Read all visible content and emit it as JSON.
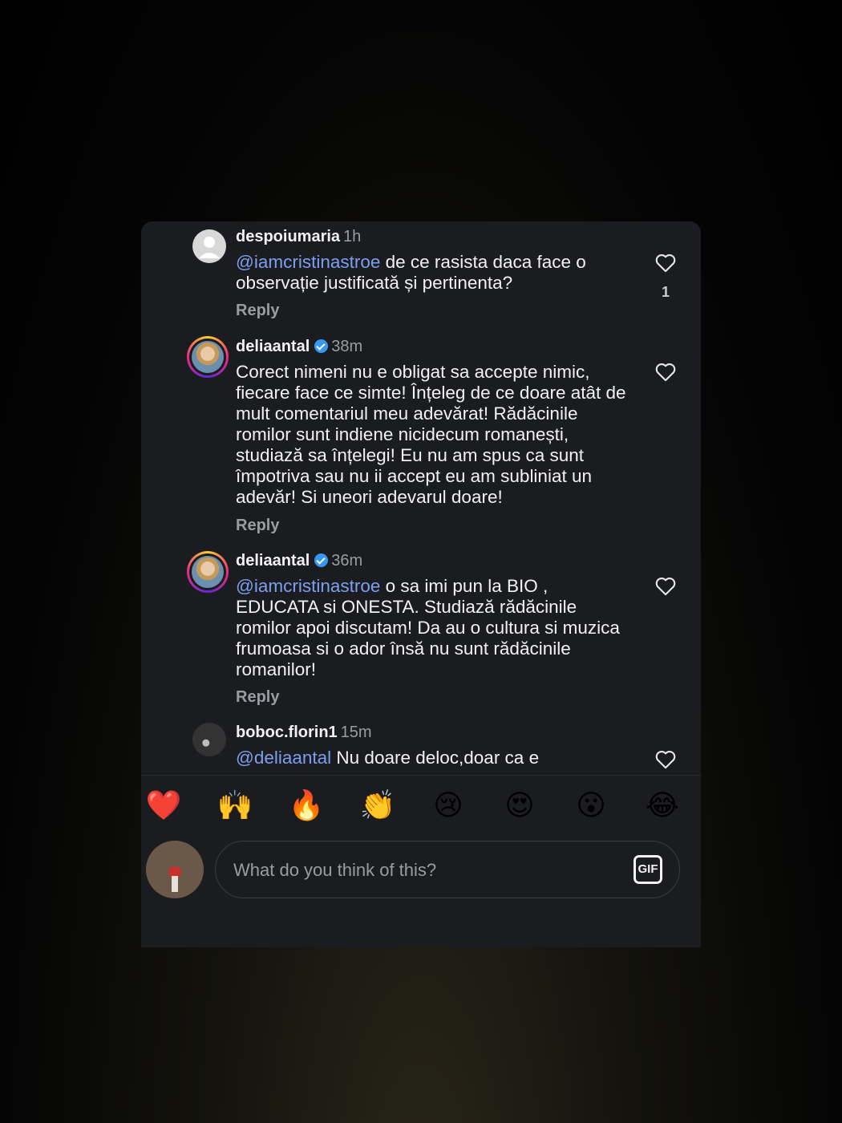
{
  "comments": [
    {
      "username": "despoiumaria",
      "time": "1h",
      "verified": false,
      "mention": "@iamcristinastroe",
      "text": " de ce rasista daca face o observație justificată și pertinenta?",
      "reply": "Reply",
      "likes": "1"
    },
    {
      "username": "deliaantal",
      "time": "38m",
      "verified": true,
      "mention": "",
      "text": "Corect nimeni nu e obligat sa accepte nimic, fiecare face ce simte! Înțeleg de ce doare atât de mult comentariul meu adevărat! Rădăcinile romilor sunt indiene nicidecum romanești, studiază sa înțelegi! Eu nu am spus ca sunt împotriva sau nu ii accept eu am subliniat un adevăr! Si uneori adevarul doare!",
      "reply": "Reply"
    },
    {
      "username": "deliaantal",
      "time": "36m",
      "verified": true,
      "mention": "@iamcristinastroe",
      "text": " o sa imi pun la BIO , EDUCATA si ONESTA. Studiază rădăcinile romilor apoi discutam! Da au o cultura si muzica frumoasa si o ador însă nu sunt rădăcinile romanilor!",
      "reply": "Reply"
    },
    {
      "username": "boboc.florin1",
      "time": "15m",
      "verified": false,
      "mention": "@deliaantal",
      "text": "  Nu doare deloc,doar ca e"
    }
  ],
  "reactions": [
    "❤️",
    "🙌",
    "🔥",
    "👏",
    "😢",
    "😍",
    "😮",
    "😂"
  ],
  "composer": {
    "placeholder": "What do you think of this?",
    "gif_label": "GIF"
  }
}
